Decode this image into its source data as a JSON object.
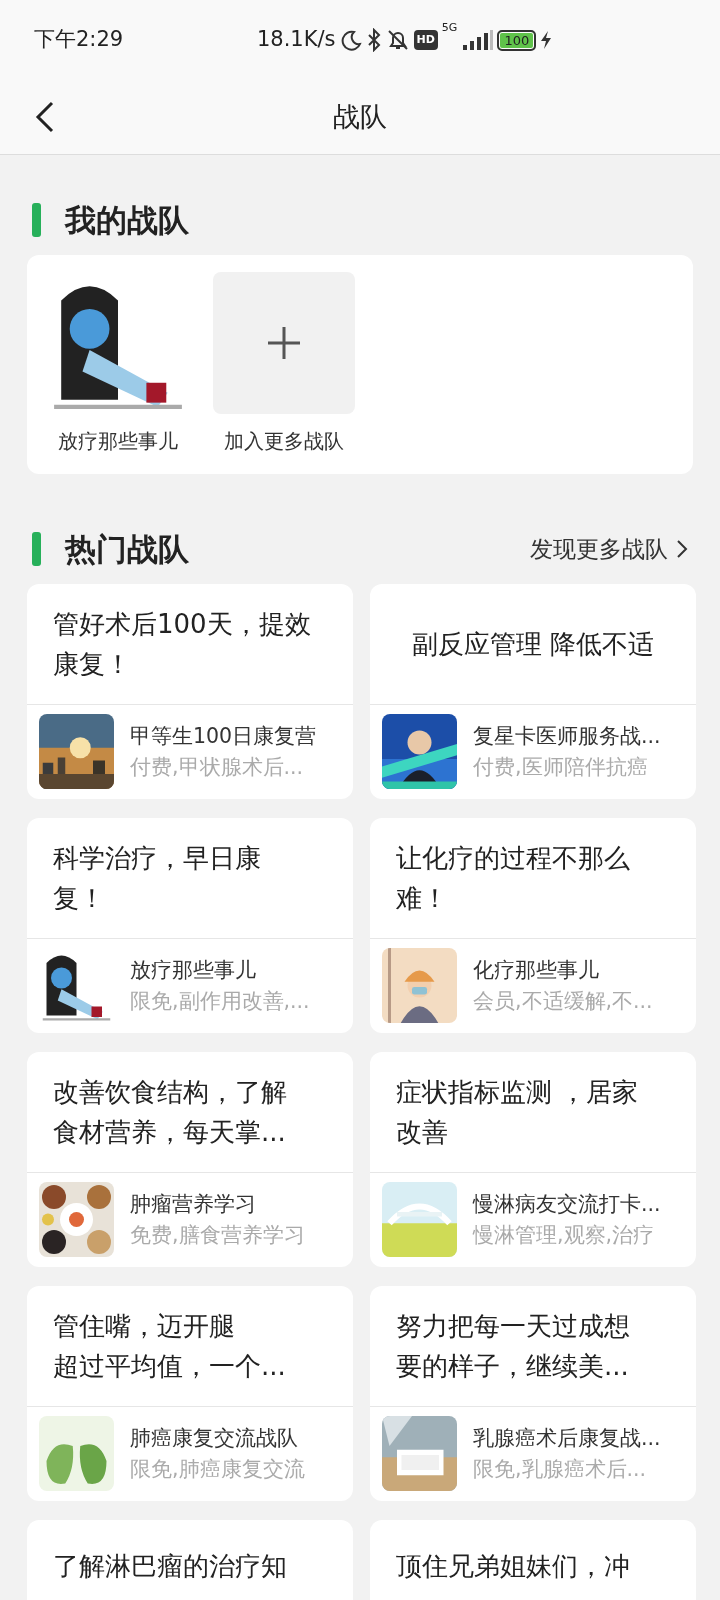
{
  "status_bar": {
    "time": "下午2:29",
    "speed": "18.1K/s",
    "hd": "HD",
    "network": "5G",
    "battery": "100"
  },
  "header": {
    "title": "战队"
  },
  "my_teams": {
    "title": "我的战队",
    "items": [
      {
        "kind": "team",
        "label": "放疗那些事儿"
      },
      {
        "kind": "add",
        "label": "加入更多战队"
      }
    ]
  },
  "hot_teams": {
    "title": "热门战队",
    "more": "发现更多战队",
    "cards": [
      {
        "title_lines": [
          "管好术后100天，提效",
          "康复！"
        ],
        "team": {
          "name": "甲等生100日康复营",
          "tags": "付费,甲状腺术后..."
        }
      },
      {
        "title_lines": [
          "副反应管理 降低不适"
        ],
        "team": {
          "name": "复星卡医师服务战...",
          "tags": "付费,医师陪伴抗癌"
        }
      },
      {
        "title_lines": [
          "科学治疗，早日康",
          "复！"
        ],
        "team": {
          "name": "放疗那些事儿",
          "tags": "限免,副作用改善,..."
        }
      },
      {
        "title_lines": [
          "让化疗的过程不那么",
          "难！"
        ],
        "team": {
          "name": "化疗那些事儿",
          "tags": "会员,不适缓解,不..."
        }
      },
      {
        "title_lines": [
          "改善饮食结构，了解",
          "食材营养，每天掌..."
        ],
        "team": {
          "name": "肿瘤营养学习",
          "tags": "免费,膳食营养学习"
        }
      },
      {
        "title_lines": [
          "症状指标监测 ，居家",
          "改善"
        ],
        "team": {
          "name": "慢淋病友交流打卡...",
          "tags": "慢淋管理,观察,治疗"
        }
      },
      {
        "title_lines": [
          "管住嘴，迈开腿",
          "超过平均值，一个..."
        ],
        "team": {
          "name": "肺癌康复交流战队",
          "tags": "限免,肺癌康复交流"
        }
      },
      {
        "title_lines": [
          "努力把每一天过成想",
          "要的样子，继续美..."
        ],
        "team": {
          "name": "乳腺癌术后康复战...",
          "tags": "限免,乳腺癌术后..."
        }
      },
      {
        "title_lines": [
          "了解淋巴瘤的治疗知"
        ]
      },
      {
        "title_lines": [
          "顶住兄弟姐妹们，冲"
        ]
      }
    ]
  }
}
